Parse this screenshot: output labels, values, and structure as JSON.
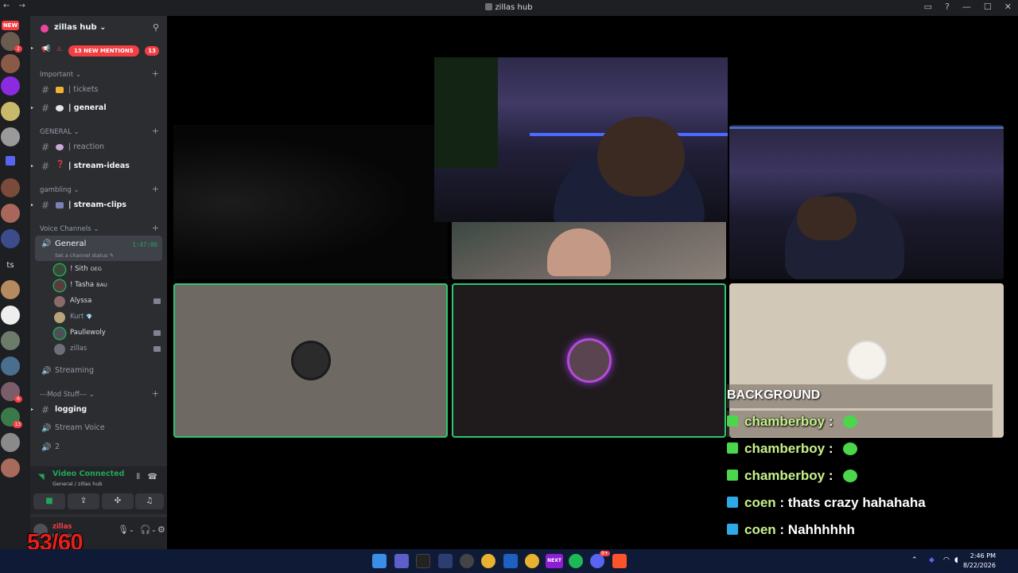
{
  "window": {
    "title": "zillas hub",
    "nav_arrows": "← →",
    "controls": [
      "▭",
      "?",
      "—",
      "☐",
      "✕"
    ]
  },
  "rail": {
    "new_label": "NEW",
    "badges": [
      "2",
      "6",
      "13"
    ],
    "text_server": "ts"
  },
  "server": {
    "name": "zillas hub ⌄",
    "mentions_label": "13 NEW MENTIONS",
    "mentions_count": "13"
  },
  "categories": {
    "important": "Important ⌄",
    "general": "GENERAL ⌄",
    "gambling": "gambling ⌄",
    "voice": "Voice Channels ⌄",
    "mod": "---Mod Stuff--- ⌄"
  },
  "channels": {
    "tickets": "| tickets",
    "general": "| general",
    "reaction": "| reaction",
    "stream_ideas": "| stream-ideas",
    "stream_clips": "| stream-clips",
    "logging": "logging",
    "stream_voice": "Stream Voice",
    "two": "2"
  },
  "voice_channel": {
    "name": "General",
    "timer": "1:47:06",
    "status": "Set a channel status ✎"
  },
  "voice_users": [
    {
      "name": "! Sith",
      "tag": "OEG"
    },
    {
      "name": "! Tasha",
      "tag": "BAU"
    },
    {
      "name": "Alyssa",
      "tag": ""
    },
    {
      "name": "Kurt",
      "tag": "💎"
    },
    {
      "name": "Paullewoly",
      "tag": ""
    },
    {
      "name": "zillas",
      "tag": ""
    }
  ],
  "streaming_label": "Streaming",
  "voice_panel": {
    "title": "Video Connected",
    "subtitle": "General / zillas hub"
  },
  "user": {
    "name": "zillas",
    "status": "Invisible"
  },
  "overlay": {
    "fps": "53/60",
    "background_label": "BACKGROUND"
  },
  "chat": [
    {
      "nick": "chamberboy",
      "sep": " : ",
      "message": ""
    },
    {
      "nick": "chamberboy",
      "sep": " : ",
      "message": ""
    },
    {
      "nick": "chamberboy",
      "sep": " : ",
      "message": ""
    },
    {
      "nick": "coen",
      "sep": " : ",
      "message": "thats crazy hahahaha"
    },
    {
      "nick": "coen",
      "sep": " : ",
      "message": "Nahhhhhh"
    }
  ],
  "taskbar": {
    "time": "2:46 PM",
    "date": "8/22/2026",
    "next_label": "NEXT",
    "discord_badge": "9+"
  },
  "colors": {
    "speaking": "#2dc770",
    "mention": "#f23f43",
    "voice_green": "#23a559",
    "chat_nick": "#c7f28b"
  }
}
